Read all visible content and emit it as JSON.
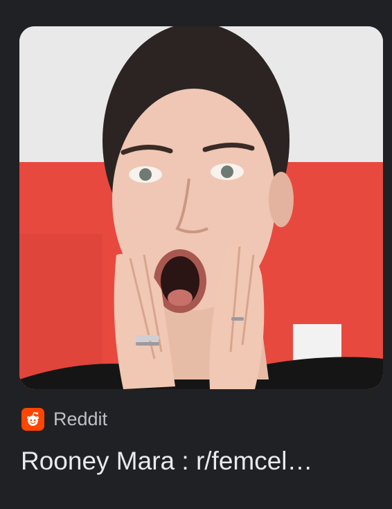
{
  "result": {
    "image_alt": "Rooney Mara",
    "source": {
      "icon": "reddit-icon",
      "name": "Reddit",
      "brand_color": "#ff4500"
    },
    "title": "Rooney Mara : r/femcel…"
  },
  "colors": {
    "background": "#202124",
    "source_text": "#bdc1c6",
    "title_text": "#e8eaed"
  }
}
